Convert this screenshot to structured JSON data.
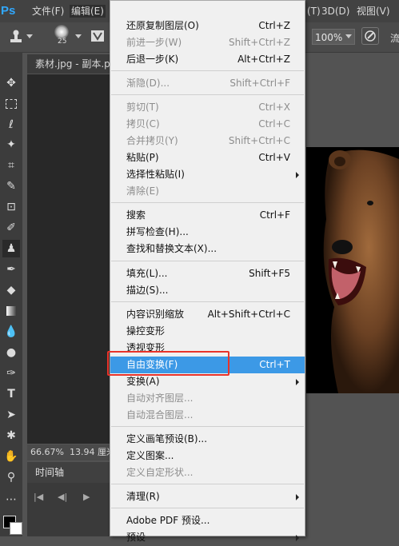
{
  "app": {
    "logo": "Ps"
  },
  "menubar": {
    "items": [
      "文件(F)",
      "编辑(E)",
      "(T)",
      "3D(D)",
      "视图(V)"
    ]
  },
  "options": {
    "brush_size": "25",
    "zoom": "100%",
    "right_text": "流"
  },
  "document": {
    "tab_title": "素材.jpg - 副本.p",
    "zoom": "66.67%",
    "size": "13.94 厘米"
  },
  "timeline": {
    "label": "时间轴"
  },
  "edit_menu": {
    "items": [
      {
        "label": "还原复制图层(O)",
        "shortcut": "Ctrl+Z",
        "enabled": true
      },
      {
        "label": "前进一步(W)",
        "shortcut": "Shift+Ctrl+Z",
        "enabled": false
      },
      {
        "label": "后退一步(K)",
        "shortcut": "Alt+Ctrl+Z",
        "enabled": true
      },
      {
        "label": "渐隐(D)...",
        "shortcut": "Shift+Ctrl+F",
        "enabled": false
      },
      {
        "label": "剪切(T)",
        "shortcut": "Ctrl+X",
        "enabled": false
      },
      {
        "label": "拷贝(C)",
        "shortcut": "Ctrl+C",
        "enabled": false
      },
      {
        "label": "合并拷贝(Y)",
        "shortcut": "Shift+Ctrl+C",
        "enabled": false
      },
      {
        "label": "粘贴(P)",
        "shortcut": "Ctrl+V",
        "enabled": true
      },
      {
        "label": "选择性粘贴(I)",
        "shortcut": "",
        "enabled": true
      },
      {
        "label": "清除(E)",
        "shortcut": "",
        "enabled": false
      },
      {
        "label": "搜索",
        "shortcut": "Ctrl+F",
        "enabled": true
      },
      {
        "label": "拼写检查(H)...",
        "shortcut": "",
        "enabled": true
      },
      {
        "label": "查找和替换文本(X)...",
        "shortcut": "",
        "enabled": true
      },
      {
        "label": "填充(L)...",
        "shortcut": "Shift+F5",
        "enabled": true
      },
      {
        "label": "描边(S)...",
        "shortcut": "",
        "enabled": true
      },
      {
        "label": "内容识别缩放",
        "shortcut": "Alt+Shift+Ctrl+C",
        "enabled": true
      },
      {
        "label": "操控变形",
        "shortcut": "",
        "enabled": true
      },
      {
        "label": "透视变形",
        "shortcut": "",
        "enabled": true
      },
      {
        "label": "自由变换(F)",
        "shortcut": "Ctrl+T",
        "enabled": true,
        "highlighted": true
      },
      {
        "label": "变换(A)",
        "shortcut": "",
        "enabled": true
      },
      {
        "label": "自动对齐图层...",
        "shortcut": "",
        "enabled": false
      },
      {
        "label": "自动混合图层...",
        "shortcut": "",
        "enabled": false
      },
      {
        "label": "定义画笔预设(B)...",
        "shortcut": "",
        "enabled": true
      },
      {
        "label": "定义图案...",
        "shortcut": "",
        "enabled": true
      },
      {
        "label": "定义自定形状...",
        "shortcut": "",
        "enabled": false
      },
      {
        "label": "清理(R)",
        "shortcut": "",
        "enabled": true
      },
      {
        "label": "Adobe PDF 预设...",
        "shortcut": "",
        "enabled": true
      },
      {
        "label": "预设",
        "shortcut": "",
        "enabled": true
      }
    ]
  },
  "colors": {
    "highlight": "#3c99e6",
    "annotation_box": "#e8332a",
    "ps_blue": "#31a8ff"
  }
}
